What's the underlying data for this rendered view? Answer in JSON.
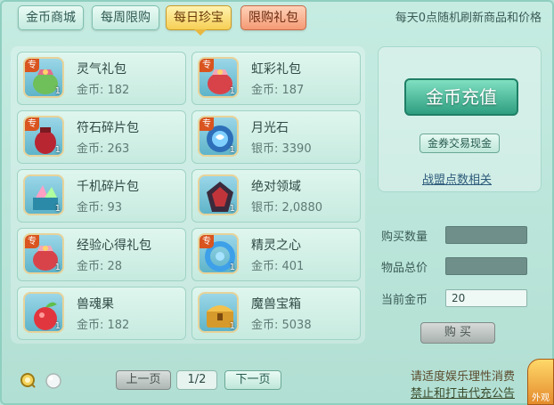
{
  "tabs": [
    {
      "label": "金币商城"
    },
    {
      "label": "每周限购"
    },
    {
      "label": "每日珍宝"
    },
    {
      "label": "限购礼包"
    }
  ],
  "notice": "每天0点随机刷新商品和价格",
  "items": [
    {
      "name": "灵气礼包",
      "price": "金币: 182",
      "tag": "专",
      "count": "1",
      "icon": "green-gift-bag-icon"
    },
    {
      "name": "虹彩礼包",
      "price": "金币: 187",
      "tag": "专",
      "count": "1",
      "icon": "red-gift-bag-icon"
    },
    {
      "name": "符石碎片包",
      "price": "金币: 263",
      "tag": "专",
      "count": "1",
      "icon": "red-pouch-icon"
    },
    {
      "name": "月光石",
      "price": "银币: 3390",
      "tag": "专",
      "count": "1",
      "icon": "moonstone-icon"
    },
    {
      "name": "千机碎片包",
      "price": "金币: 93",
      "tag": "",
      "count": "1",
      "icon": "crystal-box-icon"
    },
    {
      "name": "绝对领域",
      "price": "银币: 2,0880",
      "tag": "",
      "count": "1",
      "icon": "dark-armor-icon"
    },
    {
      "name": "经验心得礼包",
      "price": "金币: 28",
      "tag": "专",
      "count": "1",
      "icon": "red-gift-bag-icon"
    },
    {
      "name": "精灵之心",
      "price": "金币: 401",
      "tag": "专",
      "count": "1",
      "icon": "blue-ring-icon"
    },
    {
      "name": "兽魂果",
      "price": "金币: 182",
      "tag": "",
      "count": "1",
      "icon": "red-fruit-icon"
    },
    {
      "name": "魔兽宝箱",
      "price": "金币: 5038",
      "tag": "",
      "count": "1",
      "icon": "golden-chest-icon"
    }
  ],
  "right": {
    "charge_label": "金币充值",
    "exchange_label": "金券交易现金",
    "league_link": "战盟点数相关"
  },
  "form": {
    "qty_label": "购买数量",
    "total_label": "物品总价",
    "gold_label": "当前金币",
    "gold_value": "20",
    "buy_label": "购 买"
  },
  "pagination": {
    "prev": "上一页",
    "page": "1/2",
    "next": "下一页"
  },
  "footer": {
    "line1": "请适度娱乐理性消费",
    "line2": "禁止和打击代充公告",
    "badge": "外观"
  }
}
